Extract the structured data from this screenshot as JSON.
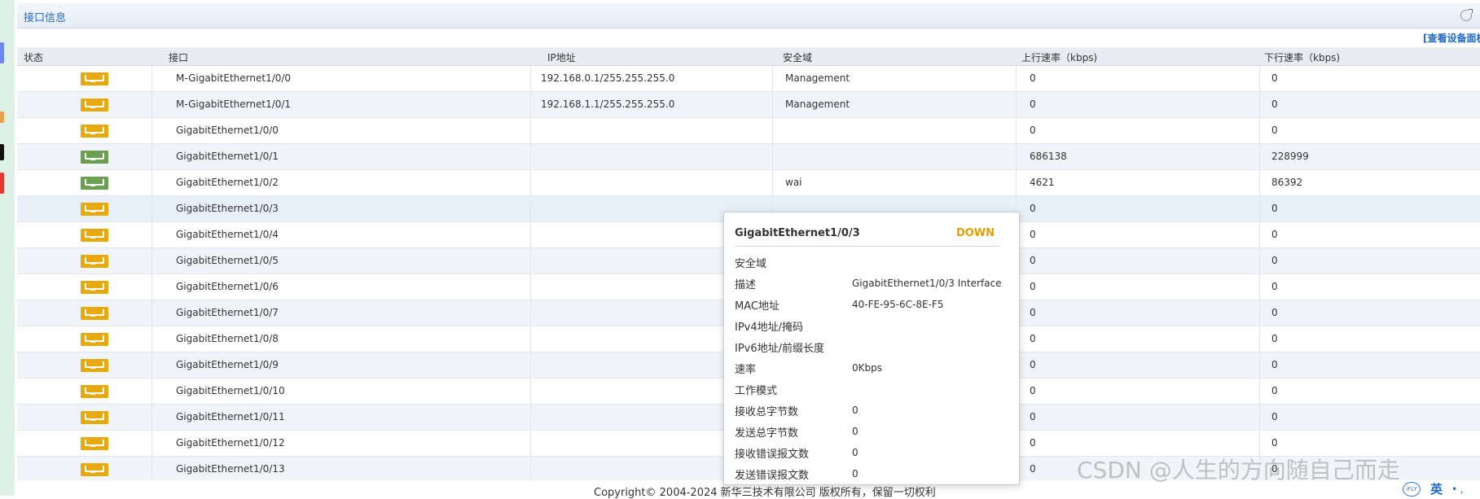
{
  "panel": {
    "title": "接口信息",
    "top_link": "[查看设备面板]"
  },
  "colors": {
    "down": "#e8a90d",
    "up": "#6aa04f",
    "status_down_text": "#e0a000"
  },
  "table": {
    "headers": [
      "状态",
      "接口",
      "IP地址",
      "安全域",
      "上行速率（kbps)",
      "下行速率（kbps)"
    ],
    "rows": [
      {
        "status": "down",
        "name": "M-GigabitEthernet1/0/0",
        "ip": "192.168.0.1/255.255.255.0",
        "zone": "Management",
        "up": "0",
        "down": "0"
      },
      {
        "status": "down",
        "name": "M-GigabitEthernet1/0/1",
        "ip": "192.168.1.1/255.255.255.0",
        "zone": "Management",
        "up": "0",
        "down": "0"
      },
      {
        "status": "down",
        "name": "GigabitEthernet1/0/0",
        "ip": "",
        "zone": "",
        "up": "0",
        "down": "0"
      },
      {
        "status": "up",
        "name": "GigabitEthernet1/0/1",
        "ip": "",
        "zone": "",
        "up": "686138",
        "down": "228999"
      },
      {
        "status": "up",
        "name": "GigabitEthernet1/0/2",
        "ip": "",
        "zone": "wai",
        "up": "4621",
        "down": "86392"
      },
      {
        "status": "down",
        "name": "GigabitEthernet1/0/3",
        "ip": "",
        "zone": "",
        "up": "0",
        "down": "0"
      },
      {
        "status": "down",
        "name": "GigabitEthernet1/0/4",
        "ip": "",
        "zone": "",
        "up": "0",
        "down": "0"
      },
      {
        "status": "down",
        "name": "GigabitEthernet1/0/5",
        "ip": "",
        "zone": "",
        "up": "0",
        "down": "0"
      },
      {
        "status": "down",
        "name": "GigabitEthernet1/0/6",
        "ip": "",
        "zone": "",
        "up": "0",
        "down": "0"
      },
      {
        "status": "down",
        "name": "GigabitEthernet1/0/7",
        "ip": "",
        "zone": "",
        "up": "0",
        "down": "0"
      },
      {
        "status": "down",
        "name": "GigabitEthernet1/0/8",
        "ip": "",
        "zone": "",
        "up": "0",
        "down": "0"
      },
      {
        "status": "down",
        "name": "GigabitEthernet1/0/9",
        "ip": "",
        "zone": "",
        "up": "0",
        "down": "0"
      },
      {
        "status": "down",
        "name": "GigabitEthernet1/0/10",
        "ip": "",
        "zone": "",
        "up": "0",
        "down": "0"
      },
      {
        "status": "down",
        "name": "GigabitEthernet1/0/11",
        "ip": "",
        "zone": "",
        "up": "0",
        "down": "0"
      },
      {
        "status": "down",
        "name": "GigabitEthernet1/0/12",
        "ip": "",
        "zone": "",
        "up": "0",
        "down": "0"
      },
      {
        "status": "down",
        "name": "GigabitEthernet1/0/13",
        "ip": "",
        "zone": "",
        "up": "0",
        "down": "0"
      }
    ]
  },
  "popup": {
    "title": "GigabitEthernet1/0/3",
    "status": "DOWN",
    "fields": [
      {
        "label": "安全域",
        "value": ""
      },
      {
        "label": "描述",
        "value": "GigabitEthernet1/0/3 Interface"
      },
      {
        "label": "MAC地址",
        "value": "40-FE-95-6C-8E-F5"
      },
      {
        "label": "IPv4地址/掩码",
        "value": ""
      },
      {
        "label": "IPv6地址/前缀长度",
        "value": ""
      },
      {
        "label": "速率",
        "value": "0Kbps"
      },
      {
        "label": "工作模式",
        "value": ""
      },
      {
        "label": "接收总字节数",
        "value": "0"
      },
      {
        "label": "发送总字节数",
        "value": "0"
      },
      {
        "label": "接收错误报文数",
        "value": "0"
      },
      {
        "label": "发送错误报文数",
        "value": "0"
      }
    ]
  },
  "footer": {
    "copyright": "Copyright© 2004-2024 新华三技术有限公司 版权所有，保留一切权利"
  },
  "watermark": {
    "text": "CSDN @人生的方向随自己而走"
  },
  "taskbar": {
    "ime_label": "英",
    "ime_dots": "• ,"
  }
}
